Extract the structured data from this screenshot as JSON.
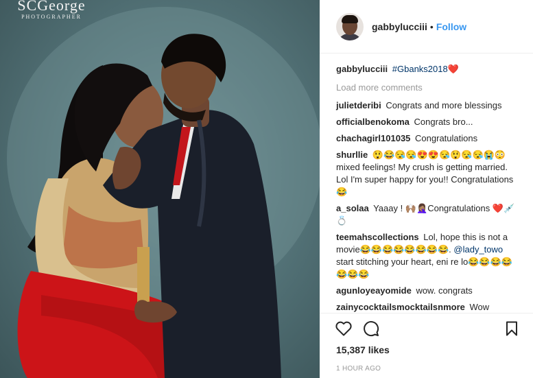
{
  "photo": {
    "watermark_name": "SCGeorge",
    "watermark_sub": "PHOTOGRAPHER"
  },
  "header": {
    "username": "gabbylucciii",
    "separator": "•",
    "follow_label": "Follow"
  },
  "caption": {
    "username": "gabbylucciii",
    "hashtag": "#Gbanks2018",
    "emoji": "❤️"
  },
  "load_more_label": "Load more comments",
  "comments": [
    {
      "user": "julietderibi",
      "text": "Congrats and more blessings"
    },
    {
      "user": "officialbenokoma",
      "text": "Congrats bro..."
    },
    {
      "user": "chachagirl101035",
      "text": "Congratulations"
    },
    {
      "user": "shurllie",
      "text": "😲😂😪😪😍😍😪😲😪😪😭😳 mixed feelings! My crush is getting married. Lol I'm super happy for you!! Congratulations 😂"
    },
    {
      "user": "a_solaa",
      "text": "Yaaay ! 🙌🏽🤦🏽‍♀️Congratulations ❤️💉💍"
    },
    {
      "user": "teemahscollections",
      "text_before": "Lol, hope this is not a movie😂😂😂😂😂😂😂😂. ",
      "mention": "@lady_towo",
      "text_after": " start stitching your heart, eni re lo😂😂😂😂😂😂😂"
    },
    {
      "user": "agunloyeayomide",
      "text": "wow. congrats"
    },
    {
      "user": "zainycocktailsmocktailsnmore",
      "text": "Wow"
    }
  ],
  "actions": {
    "like_icon": "heart-outline",
    "comment_icon": "speech-bubble",
    "save_icon": "bookmark-outline"
  },
  "likes_label": "15,387 likes",
  "timestamp": "1 HOUR AGO",
  "colors": {
    "link_blue": "#3897f0",
    "tag_blue": "#003569",
    "muted": "#999999",
    "dress_red": "#d0181c"
  }
}
